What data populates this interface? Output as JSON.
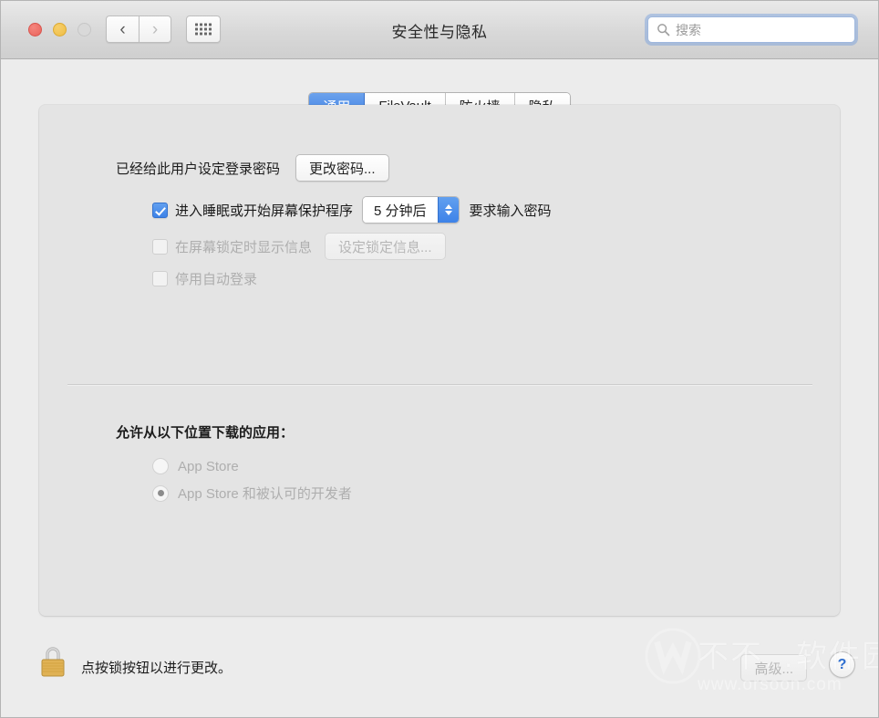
{
  "window": {
    "title": "安全性与隐私",
    "traffic_lights": {
      "close": "close-button",
      "minimize": "minimize-button",
      "maximize": "maximize-button"
    },
    "nav": {
      "back_glyph": "‹",
      "forward_glyph": "›",
      "grid_label": "show-all-grid"
    }
  },
  "search": {
    "placeholder": "搜索",
    "value": ""
  },
  "tabs": [
    {
      "label": "通用",
      "active": true
    },
    {
      "label": "FileVault",
      "active": false
    },
    {
      "label": "防火墙",
      "active": false
    },
    {
      "label": "隐私",
      "active": false
    }
  ],
  "general": {
    "password_status": "已经给此用户设定登录密码",
    "change_password_button": "更改密码...",
    "require_password": {
      "prefix": "进入睡眠或开始屏幕保护程序",
      "delay_value": "5 分钟后",
      "suffix": "要求输入密码",
      "checked": true,
      "enabled": true
    },
    "show_message": {
      "label": "在屏幕锁定时显示信息",
      "button": "设定锁定信息...",
      "checked": false,
      "enabled": false
    },
    "disable_auto_login": {
      "label": "停用自动登录",
      "checked": false,
      "enabled": false
    },
    "download_section": {
      "title": "允许从以下位置下载的应用：",
      "options": [
        {
          "label": "App Store",
          "selected": false
        },
        {
          "label": "App Store 和被认可的开发者",
          "selected": true
        }
      ],
      "enabled": false
    }
  },
  "footer": {
    "lock_icon": "lock-closed-icon",
    "lock_text": "点按锁按钮以进行更改。",
    "advanced_button": "高级...",
    "advanced_enabled": false,
    "help_button": "?"
  },
  "watermark": {
    "text_cn": "不不…软件园",
    "url": "www.orsoon.com"
  },
  "colors": {
    "accent_blue": "#3d82e8",
    "tab_active_blue": "#3b7fe4",
    "window_bg": "#ececec",
    "panel_bg": "#e4e4e4",
    "lock_gold": "#e0b255"
  }
}
